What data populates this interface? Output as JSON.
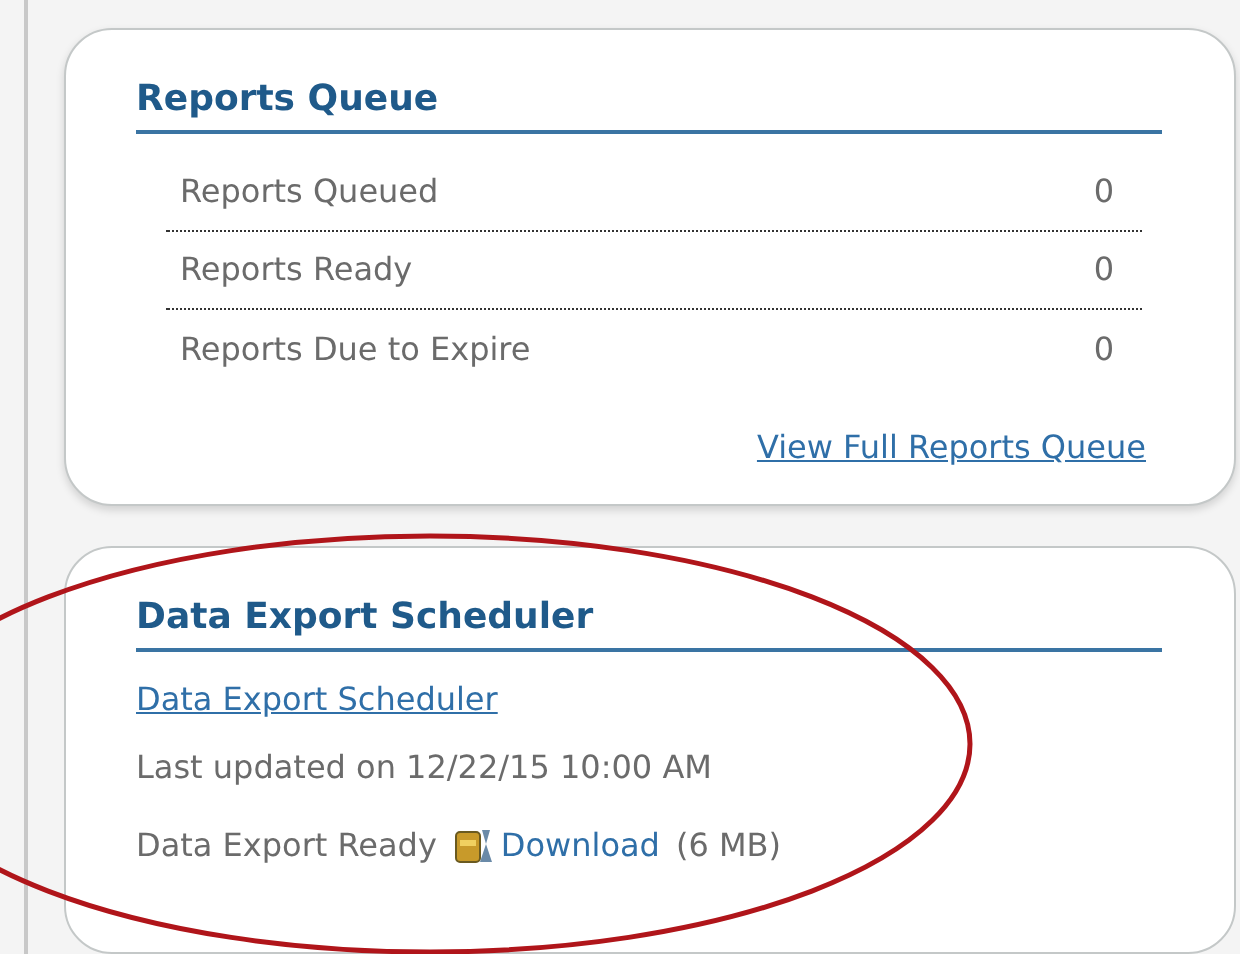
{
  "reports_queue": {
    "title": "Reports Queue",
    "rows": [
      {
        "label": "Reports Queued",
        "value": "0"
      },
      {
        "label": "Reports Ready",
        "value": "0"
      },
      {
        "label": "Reports Due to Expire",
        "value": "0"
      }
    ],
    "link": "View Full Reports Queue"
  },
  "data_export": {
    "title": "Data Export Scheduler",
    "link": "Data Export Scheduler",
    "last_updated": "Last updated on 12/22/15 10:00 AM",
    "status": "Data Export Ready",
    "download": "Download",
    "size": "(6 MB)"
  }
}
